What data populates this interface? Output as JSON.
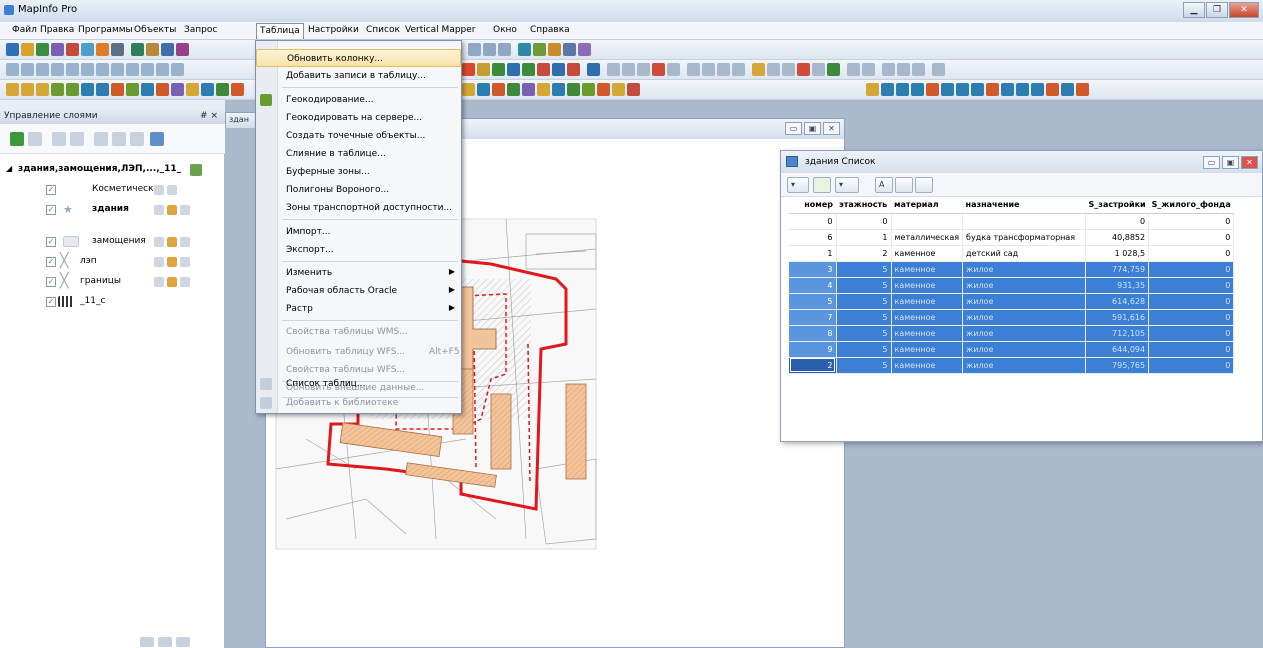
{
  "app": {
    "title": "MapInfo Pro"
  },
  "menu": [
    "Файл",
    "Правка",
    "Программы",
    "Объекты",
    "Запрос",
    "Таблица",
    "Настройки",
    "Список",
    "Vertical Mapper",
    "Окно",
    "Справка"
  ],
  "dropdown": [
    {
      "label": "Обновить колонку...",
      "state": "highlighted"
    },
    {
      "label": "Добавить записи в таблицу..."
    },
    {
      "label": "Геокодирование..."
    },
    {
      "label": "Геокодировать на сервере..."
    },
    {
      "label": "Создать точечные объекты..."
    },
    {
      "label": "Слияние в таблице..."
    },
    {
      "label": "Буферные зоны..."
    },
    {
      "label": "Полигоны Вороного..."
    },
    {
      "label": "Зоны транспортной доступности..."
    },
    {
      "label": "Импорт..."
    },
    {
      "label": "Экспорт..."
    },
    {
      "label": "Изменить",
      "submenu": true
    },
    {
      "label": "Рабочая область Oracle",
      "submenu": true
    },
    {
      "label": "Растр",
      "submenu": true
    },
    {
      "label": "Свойства таблицы WMS...",
      "state": "disabled"
    },
    {
      "label": "Обновить таблицу WFS...",
      "shortcut": "Alt+F5",
      "state": "disabled"
    },
    {
      "label": "Свойства таблицы WFS...",
      "state": "disabled"
    },
    {
      "label": "Обновить внешние данные...",
      "state": "disabled"
    },
    {
      "label": "Список таблиц..."
    },
    {
      "label": "Добавить к библиотеке",
      "state": "disabled"
    }
  ],
  "layer_panel": {
    "title": "Управление слоями",
    "close": "# ×",
    "group": "здания,замощения,ЛЭП,...,_11_",
    "layers": [
      {
        "name": "Косметически",
        "checked": true
      },
      {
        "name": "здания",
        "checked": true,
        "bold": true
      },
      {
        "name": "замощения",
        "checked": true
      },
      {
        "name": "лэп",
        "checked": true
      },
      {
        "name": "границы",
        "checked": true
      },
      {
        "name": "_11_с",
        "checked": true
      }
    ]
  },
  "map_tab": "здан",
  "list_window": {
    "title": "здания Список",
    "columns": [
      "номер",
      "этажность",
      "материал",
      "назначение",
      "S_застройки",
      "S_жилого_фонда"
    ],
    "rows": [
      {
        "номер": "0",
        "этажность": "0",
        "материал": "",
        "назначение": "",
        "S_застройки": "0",
        "S_жилого_фонда": "0",
        "selected": false
      },
      {
        "номер": "6",
        "этажность": "1",
        "материал": "металлическая",
        "назначение": "будка трансформаторная",
        "S_застройки": "40,8852",
        "S_жилого_фонда": "0",
        "selected": false
      },
      {
        "номер": "1",
        "этажность": "2",
        "материал": "каменное",
        "назначение": "детский сад",
        "S_застройки": "1 028,5",
        "S_жилого_фонда": "0",
        "selected": false
      },
      {
        "номер": "3",
        "этажность": "5",
        "материал": "каменное",
        "назначение": "жилое",
        "S_застройки": "774,759",
        "S_жилого_фонда": "0",
        "selected": true
      },
      {
        "номер": "4",
        "этажность": "5",
        "материал": "каменное",
        "назначение": "жилое",
        "S_застройки": "931,35",
        "S_жилого_фонда": "0",
        "selected": true
      },
      {
        "номер": "5",
        "этажность": "5",
        "материал": "каменное",
        "назначение": "жилое",
        "S_застройки": "614,628",
        "S_жилого_фонда": "0",
        "selected": true
      },
      {
        "номер": "7",
        "этажность": "5",
        "материал": "каменное",
        "назначение": "жилое",
        "S_застройки": "591,616",
        "S_жилого_фонда": "0",
        "selected": true
      },
      {
        "номер": "8",
        "этажность": "5",
        "материал": "каменное",
        "назначение": "жилое",
        "S_застройки": "712,105",
        "S_жилого_фонда": "0",
        "selected": true
      },
      {
        "номер": "9",
        "этажность": "5",
        "материал": "каменное",
        "назначение": "жилое",
        "S_застройки": "644,094",
        "S_жилого_фонда": "0",
        "selected": true
      },
      {
        "номер": "2",
        "этажность": "5",
        "материал": "каменное",
        "назначение": "жилое",
        "S_застройки": "795,765",
        "S_жилого_фонда": "0",
        "selected": true,
        "focused": true
      }
    ]
  },
  "colors": {
    "accent": "#3c7fd4",
    "boundary": "#e0171c",
    "building": "#f3c49a"
  }
}
